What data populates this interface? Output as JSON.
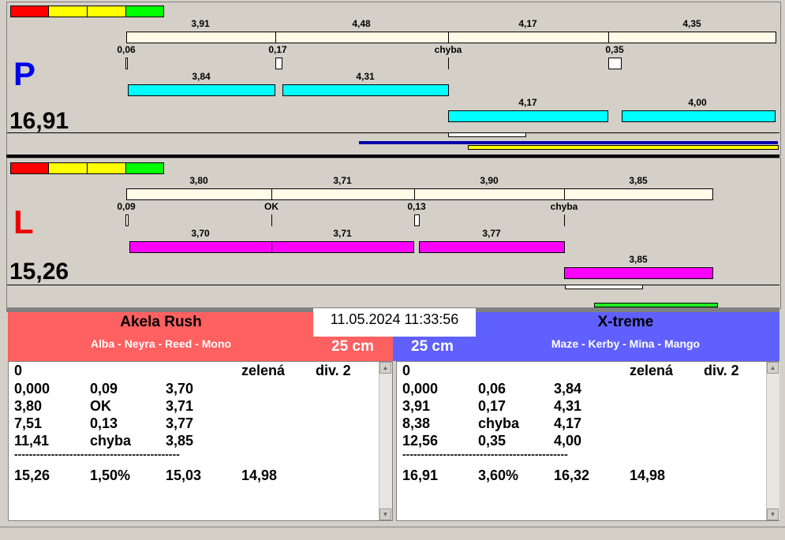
{
  "top": {
    "letter": "P",
    "total": "16,91",
    "seg_labels": [
      "3,91",
      "4,48",
      "4,17",
      "4,35"
    ],
    "small_labels": [
      "0,06",
      "0,17",
      "chyba",
      "0,35"
    ],
    "run1": [
      "3,84",
      "4,31"
    ],
    "run2": [
      "4,17",
      "4,00"
    ]
  },
  "bottom": {
    "letter": "L",
    "total": "15,26",
    "seg_labels": [
      "3,80",
      "3,71",
      "3,90",
      "3,85"
    ],
    "small_labels": [
      "0,09",
      "OK",
      "0,13",
      "chyba"
    ],
    "run1": [
      "3,70",
      "3,71",
      "3,77"
    ],
    "run2": [
      "3,85"
    ]
  },
  "datetime": "11.05.2024 11:33:56",
  "left_team": {
    "name": "Akela Rush",
    "dogs": "Alba - Neyra - Reed - Mono",
    "size": "25 cm",
    "rows": [
      [
        "0",
        "",
        "",
        "zelená",
        "div. 2"
      ],
      [
        "0,000",
        "0,09",
        "3,70",
        "",
        ""
      ],
      [
        "3,80",
        "OK",
        "3,71",
        "",
        ""
      ],
      [
        "7,51",
        "0,13",
        "3,77",
        "",
        ""
      ],
      [
        "11,41",
        "chyba",
        "3,85",
        "",
        ""
      ]
    ],
    "separator": "---------------------------------------------",
    "summary": [
      "15,26",
      "1,50%",
      "15,03",
      "14,98"
    ]
  },
  "right_team": {
    "name": "X-treme",
    "dogs": "Maze - Kerby - Mina - Mango",
    "size": "25 cm",
    "rows": [
      [
        "0",
        "",
        "",
        "zelená",
        "div. 2"
      ],
      [
        "0,000",
        "0,06",
        "3,84",
        "",
        ""
      ],
      [
        "3,91",
        "0,17",
        "4,31",
        "",
        ""
      ],
      [
        "8,38",
        "chyba",
        "4,17",
        "",
        ""
      ],
      [
        "12,56",
        "0,35",
        "4,00",
        "",
        ""
      ]
    ],
    "separator": "---------------------------------------------",
    "summary": [
      "16,91",
      "3,60%",
      "16,32",
      "14,98"
    ]
  },
  "colors": {
    "red": "#ff0000",
    "yellow": "#ffff00",
    "green": "#00ff00",
    "left": "#ff6060",
    "right": "#6060ff"
  }
}
